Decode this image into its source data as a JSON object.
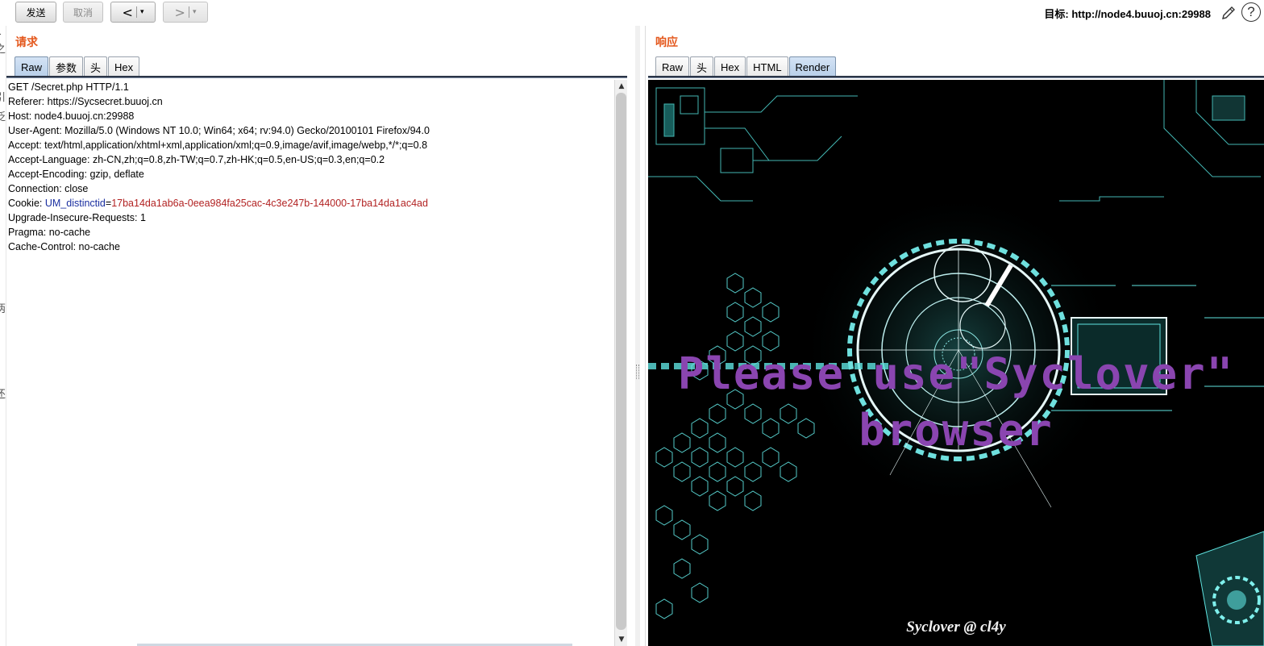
{
  "toolbar": {
    "send_label": "发送",
    "cancel_label": "取消",
    "back_symbol": "<",
    "forward_symbol": ">",
    "dropdown_symbol": "▾",
    "target_text": "目标: http://node4.buuoj.cn:29988",
    "edit_icon": "pencil-icon",
    "help_icon": "help-icon",
    "help_symbol": "?"
  },
  "request": {
    "title": "请求",
    "tabs": [
      "Raw",
      "参数",
      "头",
      "Hex"
    ],
    "active_tab": "Raw",
    "lines": [
      "GET /Secret.php HTTP/1.1",
      "Referer: https://Sycsecret.buuoj.cn",
      "Host: node4.buuoj.cn:29988",
      "User-Agent: Mozilla/5.0 (Windows NT 10.0; Win64; x64; rv:94.0) Gecko/20100101 Firefox/94.0",
      "Accept: text/html,application/xhtml+xml,application/xml;q=0.9,image/avif,image/webp,*/*;q=0.8",
      "Accept-Language: zh-CN,zh;q=0.8,zh-TW;q=0.7,zh-HK;q=0.5,en-US;q=0.3,en;q=0.2",
      "Accept-Encoding: gzip, deflate",
      "Connection: close"
    ],
    "cookie": {
      "prefix": "Cookie: ",
      "name": "UM_distinctid",
      "eq": "=",
      "value": "17ba14da1ab6a-0eea984fa25cac-4c3e247b-144000-17ba14da1ac4ad"
    },
    "lines_after": [
      "Upgrade-Insecure-Requests: 1",
      "Pragma: no-cache",
      "Cache-Control: no-cache"
    ]
  },
  "response": {
    "title": "响应",
    "tabs": [
      "Raw",
      "头",
      "Hex",
      "HTML",
      "Render"
    ],
    "active_tab": "Render",
    "render_line1": "Please use\"Syclover\"",
    "render_line2": "browser",
    "render_footer": "Syclover @ cl4y",
    "colors": {
      "message": "#8a45b0",
      "accent": "#5fe3e0",
      "background": "#000000"
    }
  },
  "left_edge_glyphs": [
    "1",
    "之",
    "引",
    "泛",
    "两",
    "还"
  ]
}
